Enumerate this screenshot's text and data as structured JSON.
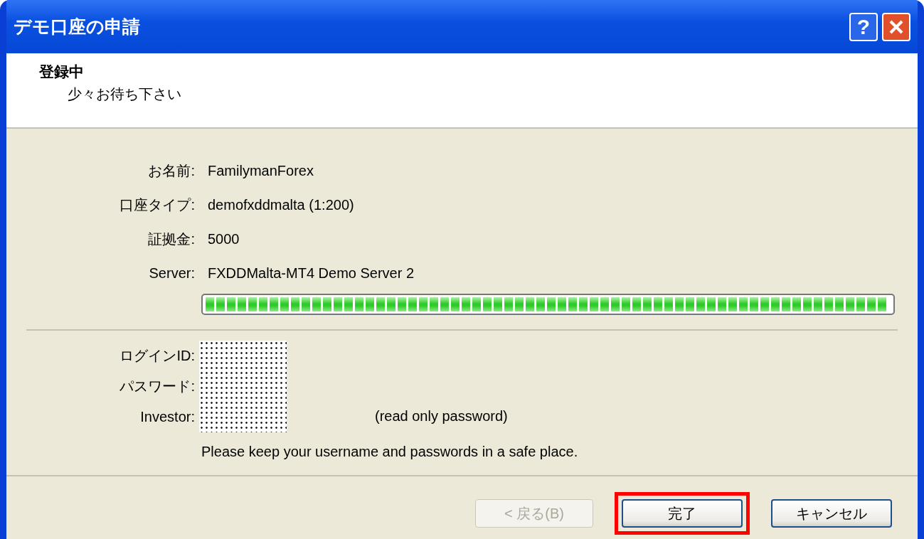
{
  "window": {
    "title": "デモ口座の申請"
  },
  "title_buttons": [
    {
      "kind": "help",
      "label": "?"
    },
    {
      "kind": "close"
    }
  ],
  "header": {
    "title": "登録中",
    "subtitle": "少々お待ち下さい"
  },
  "info_rows": [
    {
      "label": "お名前:",
      "value": "FamilymanForex"
    },
    {
      "label": "口座タイプ:",
      "value": "demofxddmalta (1:200)"
    },
    {
      "label": "証拠金:",
      "value": "5000"
    },
    {
      "label": "Server:",
      "value": "FXDDMalta-MT4 Demo Server 2"
    }
  ],
  "progress": {
    "level": 1
  },
  "credentials": {
    "labels": [
      "ログインID:",
      "パスワード:",
      "Investor:"
    ],
    "investor_note": "(read only password)",
    "notice": "Please keep your username and passwords in a safe place."
  },
  "buttons": [
    {
      "label": "< 戻る(B)",
      "disabled": true,
      "highlighted": false
    },
    {
      "label": "完了",
      "disabled": false,
      "highlighted": true
    },
    {
      "label": "キャンセル",
      "disabled": false,
      "highlighted": false
    }
  ]
}
